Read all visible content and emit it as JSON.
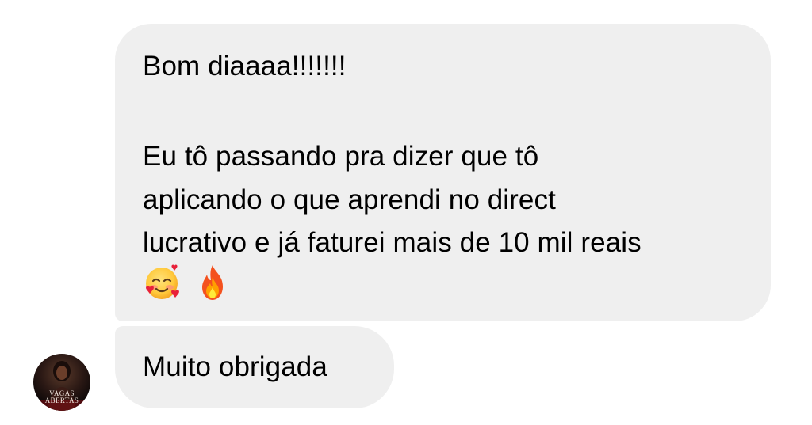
{
  "conversation": {
    "messages": [
      {
        "lines": [
          "Bom diaaaa!!!!!!!",
          "Eu tô passando pra dizer que tô",
          "aplicando o que aprendi no direct",
          "lucrativo e já faturei mais de 10 mil reais"
        ],
        "emojis": [
          "smiling-face-with-hearts-icon",
          "fire-icon"
        ]
      },
      {
        "text": "Muito obrigada"
      }
    ],
    "sender_avatar": {
      "text_line_1": "VAGAS",
      "text_line_2": "ABERTAS"
    }
  },
  "colors": {
    "bubble": "#efefef",
    "text": "#000000",
    "background": "#ffffff"
  }
}
